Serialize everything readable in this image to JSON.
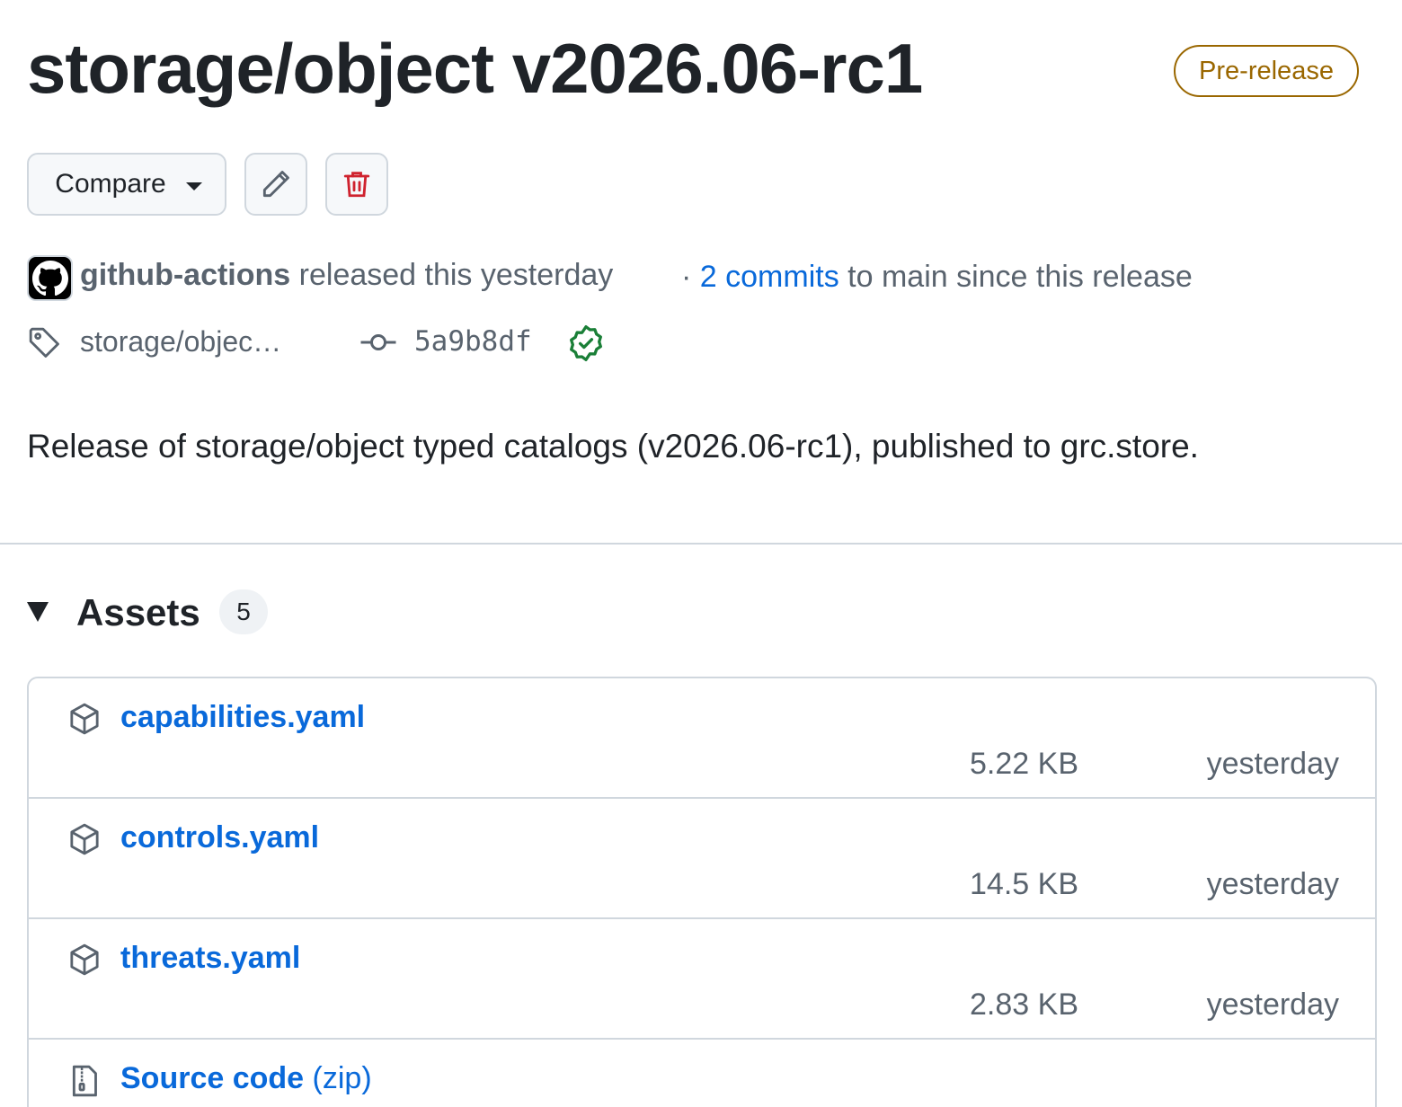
{
  "release": {
    "title": "storage/object v2026.06-rc1",
    "badge": "Pre-release",
    "colors": {
      "prerelease": "#9a6700",
      "link": "#0969da",
      "danger": "#cf222e",
      "verified": "#1a7f37"
    }
  },
  "toolbar": {
    "compare_label": "Compare",
    "edit_icon": "pencil-icon",
    "delete_icon": "trash-icon"
  },
  "meta": {
    "author": "github-actions",
    "released_text": "released this yesterday",
    "commits_prefix": "·",
    "commits_link": "2 commits",
    "commits_suffix": "to main since this release",
    "tag": "storage/objec…",
    "sha": "5a9b8df"
  },
  "description": "Release of storage/object typed catalogs (v2026.06-rc1), published to grc.store.",
  "assets": {
    "title": "Assets",
    "count": "5",
    "items": [
      {
        "name": "capabilities.yaml",
        "size": "5.22 KB",
        "date": "yesterday",
        "icon": "package-icon"
      },
      {
        "name": "controls.yaml",
        "size": "14.5 KB",
        "date": "yesterday",
        "icon": "package-icon"
      },
      {
        "name": "threats.yaml",
        "size": "2.83 KB",
        "date": "yesterday",
        "icon": "package-icon"
      },
      {
        "name": "Source code",
        "suffix": "(zip)",
        "icon": "file-zip-icon"
      }
    ]
  }
}
